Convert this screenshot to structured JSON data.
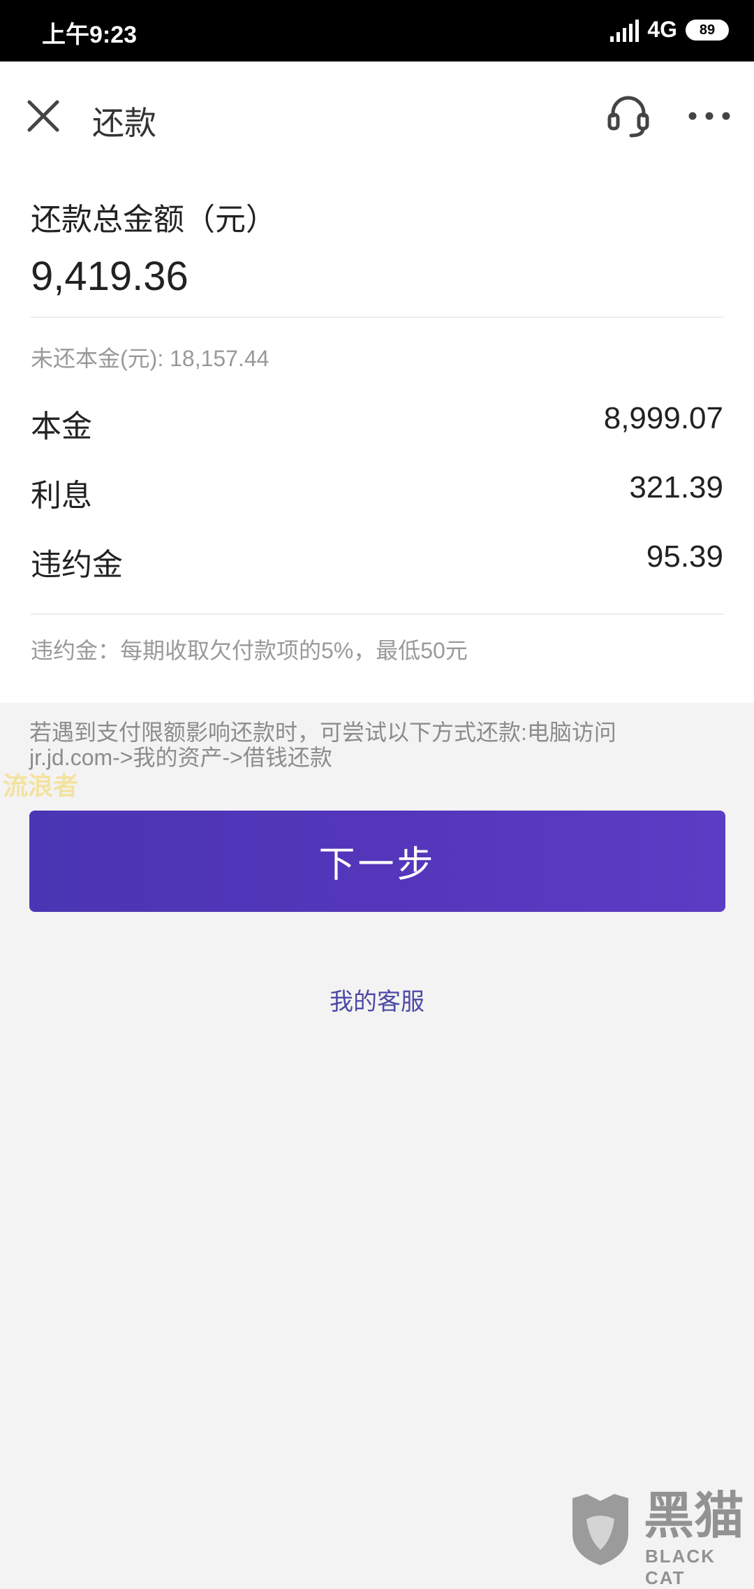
{
  "status_bar": {
    "time": "上午9:23",
    "network": "4G",
    "battery": "89"
  },
  "header": {
    "title": "还款",
    "close_icon": "close-icon",
    "service_icon": "headset-icon",
    "more_icon": "more-horizontal-icon"
  },
  "summary": {
    "total_label": "还款总金额（元）",
    "total_amount": "9,419.36",
    "unpaid_principal": "未还本金(元): 18,157.44"
  },
  "breakdown": [
    {
      "label": "本金",
      "value": "8,999.07"
    },
    {
      "label": "利息",
      "value": "321.39"
    },
    {
      "label": "违约金",
      "value": "95.39"
    }
  ],
  "penalty_note": "违约金：每期收取欠付款项的5%，最低50元",
  "tip": {
    "line1": "若遇到支付限额影响还款时，可尝试以下方式还款:电脑访问",
    "line2": "jr.jd.com->我的资产->借钱还款"
  },
  "watermark_text": "流浪者",
  "next_button": "下一步",
  "customer_service_link": "我的客服",
  "brand_watermark": {
    "title": "黑猫",
    "subtitle": "BLACK CAT"
  },
  "colors": {
    "primary_button": "#5436ba",
    "link": "#4d4aa6",
    "status_bar": "#000000",
    "background": "#f3f3f3"
  }
}
